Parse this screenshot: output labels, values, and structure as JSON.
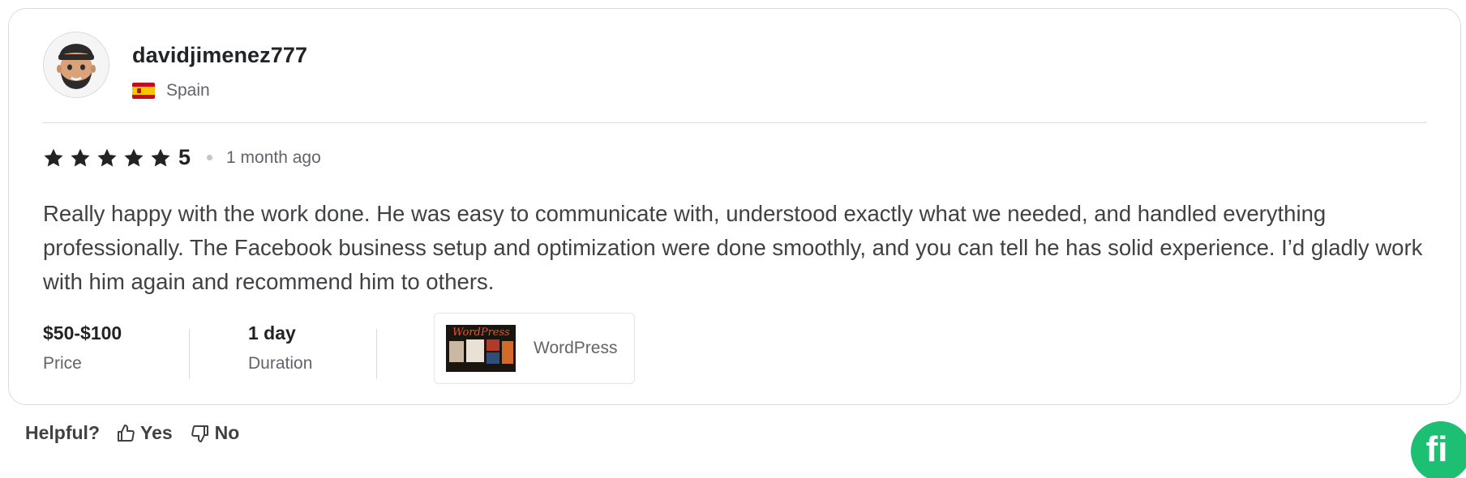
{
  "review": {
    "username": "davidjimenez777",
    "country": "Spain",
    "rating": "5",
    "stars_filled": 5,
    "timestamp": "1 month ago",
    "text": "Really happy with the work done. He was easy to communicate with, understood exactly what we needed, and handled everything professionally. The Facebook business setup and optimization were done smoothly, and you can tell he has solid experience. I’d gladly work with him again and recommend him to others.",
    "price": {
      "value": "$50-$100",
      "label": "Price"
    },
    "duration": {
      "value": "1 day",
      "label": "Duration"
    },
    "gig": {
      "label": "WordPress",
      "thumb_title": "WordPress"
    }
  },
  "helpful": {
    "label": "Helpful?",
    "yes_label": "Yes",
    "no_label": "No"
  },
  "badge": {
    "glyph": "fi"
  },
  "icons": {
    "avatar": "avatar-icon",
    "flag": "spain-flag-icon",
    "star": "star-icon",
    "thumbs_up": "thumbs-up-icon",
    "thumbs_down": "thumbs-down-icon",
    "brand": "fiverr-logo-icon"
  },
  "colors": {
    "text_primary": "#222325",
    "text_secondary": "#62646a",
    "border": "#dadbdd",
    "brand_green": "#1dbf73"
  }
}
